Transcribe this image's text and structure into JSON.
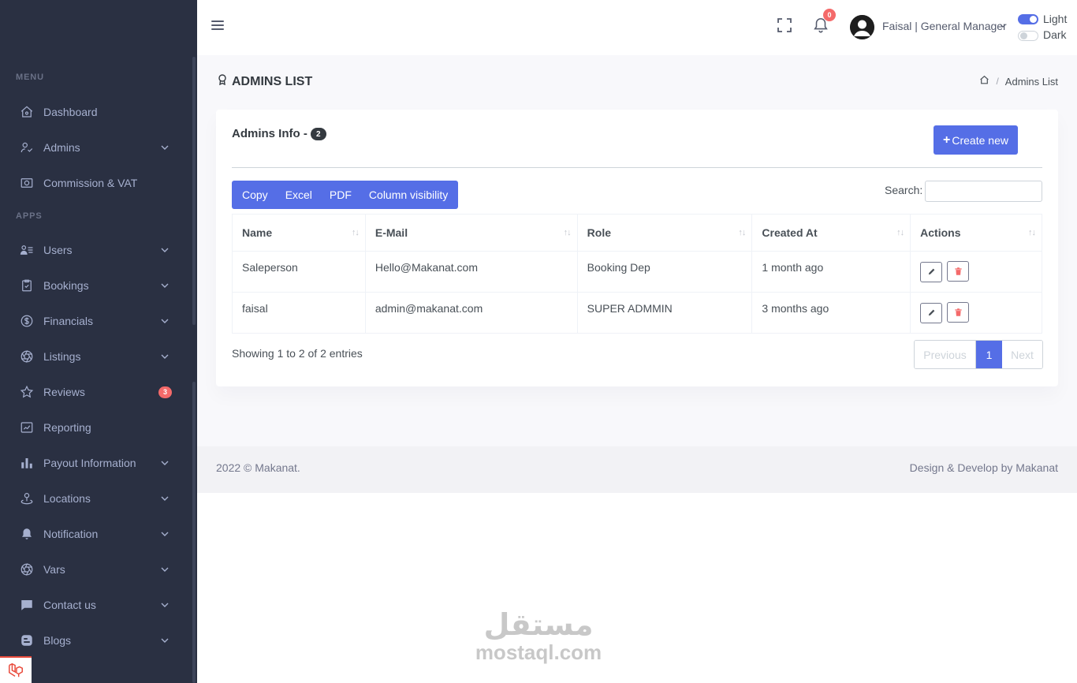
{
  "sidebar": {
    "menu_title": "MENU",
    "apps_title": "APPS",
    "items": [
      {
        "label": "Dashboard",
        "icon": "home-icon"
      },
      {
        "label": "Admins",
        "icon": "user-check-icon"
      },
      {
        "label": "Commission & VAT",
        "icon": "camera-icon"
      },
      {
        "label": "Users",
        "icon": "users-list-icon"
      },
      {
        "label": "Bookings",
        "icon": "clipboard-icon"
      },
      {
        "label": "Financials",
        "icon": "dollar-icon"
      },
      {
        "label": "Listings",
        "icon": "aperture-icon"
      },
      {
        "label": "Reviews",
        "icon": "star-icon",
        "badge": "3"
      },
      {
        "label": "Reporting",
        "icon": "chart-icon"
      },
      {
        "label": "Payout Information",
        "icon": "bar-chart-icon"
      },
      {
        "label": "Locations",
        "icon": "map-pin-icon"
      },
      {
        "label": "Notification",
        "icon": "bell-icon"
      },
      {
        "label": "Vars",
        "icon": "aperture-icon"
      },
      {
        "label": "Contact us",
        "icon": "chat-icon"
      },
      {
        "label": "Blogs",
        "icon": "blog-icon"
      }
    ]
  },
  "header": {
    "notification_count": "0",
    "user_name": "Faisal | General Manager",
    "light_label": "Light",
    "dark_label": "Dark",
    "light_mode_on": true
  },
  "page": {
    "title": "ADMINS LIST",
    "breadcrumb_current": "Admins List"
  },
  "card": {
    "title": "Admins Info -",
    "count": "2",
    "create_label": "Create new",
    "export_buttons": [
      "Copy",
      "Excel",
      "PDF",
      "Column visibility"
    ],
    "search_label": "Search:",
    "search_value": ""
  },
  "table": {
    "columns": [
      "Name",
      "E-Mail",
      "Role",
      "Created At",
      "Actions"
    ],
    "rows": [
      [
        "Saleperson",
        "Hello@Makanat.com",
        "Booking Dep",
        "1 month ago"
      ],
      [
        "faisal",
        "admin@makanat.com",
        "SUPER ADMMIN",
        "3 months ago"
      ]
    ]
  },
  "pagination": {
    "info": "Showing 1 to 2 of 2 entries",
    "previous": "Previous",
    "current": "1",
    "next": "Next"
  },
  "footer": {
    "left": "2022 © Makanat.",
    "right": "Design & Develop by Makanat"
  },
  "watermark": {
    "arabic": "مستقل",
    "latin": "mostaql.com"
  },
  "colors": {
    "sidebar_bg": "#2a3042",
    "primary": "#556ee6",
    "danger": "#f46a6a"
  }
}
